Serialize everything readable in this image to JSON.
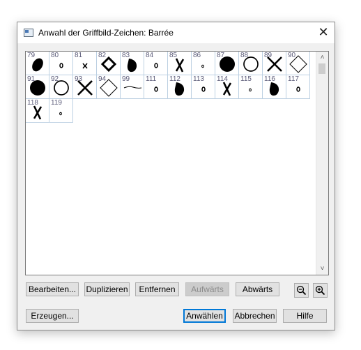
{
  "dialog": {
    "title": "Anwahl der Griffbild-Zeichen: Barrée",
    "close_symbol": "✕"
  },
  "symbols": [
    {
      "num": "79",
      "shape": "filled-tilted-oval"
    },
    {
      "num": "80",
      "shape": "small-ring"
    },
    {
      "num": "81",
      "shape": "small-x"
    },
    {
      "num": "82",
      "shape": "diamond-thick"
    },
    {
      "num": "83",
      "shape": "filled-blob"
    },
    {
      "num": "84",
      "shape": "small-ring"
    },
    {
      "num": "85",
      "shape": "bold-x"
    },
    {
      "num": "86",
      "shape": "tiny-dot"
    },
    {
      "num": "87",
      "shape": "filled-circle"
    },
    {
      "num": "88",
      "shape": "open-circle"
    },
    {
      "num": "89",
      "shape": "large-x"
    },
    {
      "num": "90",
      "shape": "diamond-thin"
    },
    {
      "num": "91",
      "shape": "filled-circle"
    },
    {
      "num": "92",
      "shape": "open-circle"
    },
    {
      "num": "93",
      "shape": "large-x"
    },
    {
      "num": "94",
      "shape": "diamond-thin"
    },
    {
      "num": "99",
      "shape": "tilde"
    },
    {
      "num": "111",
      "shape": "small-ring"
    },
    {
      "num": "112",
      "shape": "filled-blob"
    },
    {
      "num": "113",
      "shape": "small-ring"
    },
    {
      "num": "114",
      "shape": "bold-x"
    },
    {
      "num": "115",
      "shape": "tiny-dot"
    },
    {
      "num": "116",
      "shape": "filled-blob"
    },
    {
      "num": "117",
      "shape": "small-ring"
    },
    {
      "num": "118",
      "shape": "bold-x"
    },
    {
      "num": "119",
      "shape": "tiny-dot"
    }
  ],
  "scrollbar": {
    "up": "˄",
    "down": "˅"
  },
  "buttons": {
    "edit": "Bearbeiten...",
    "duplicate": "Duplizieren",
    "remove": "Entfernen",
    "up": "Aufwärts",
    "down": "Abwärts",
    "create": "Erzeugen...",
    "select": "Anwählen",
    "cancel": "Abbrechen",
    "help": "Hilfe"
  },
  "icons": {
    "zoom_out": "zoom-out-icon",
    "zoom_in": "zoom-in-icon"
  }
}
